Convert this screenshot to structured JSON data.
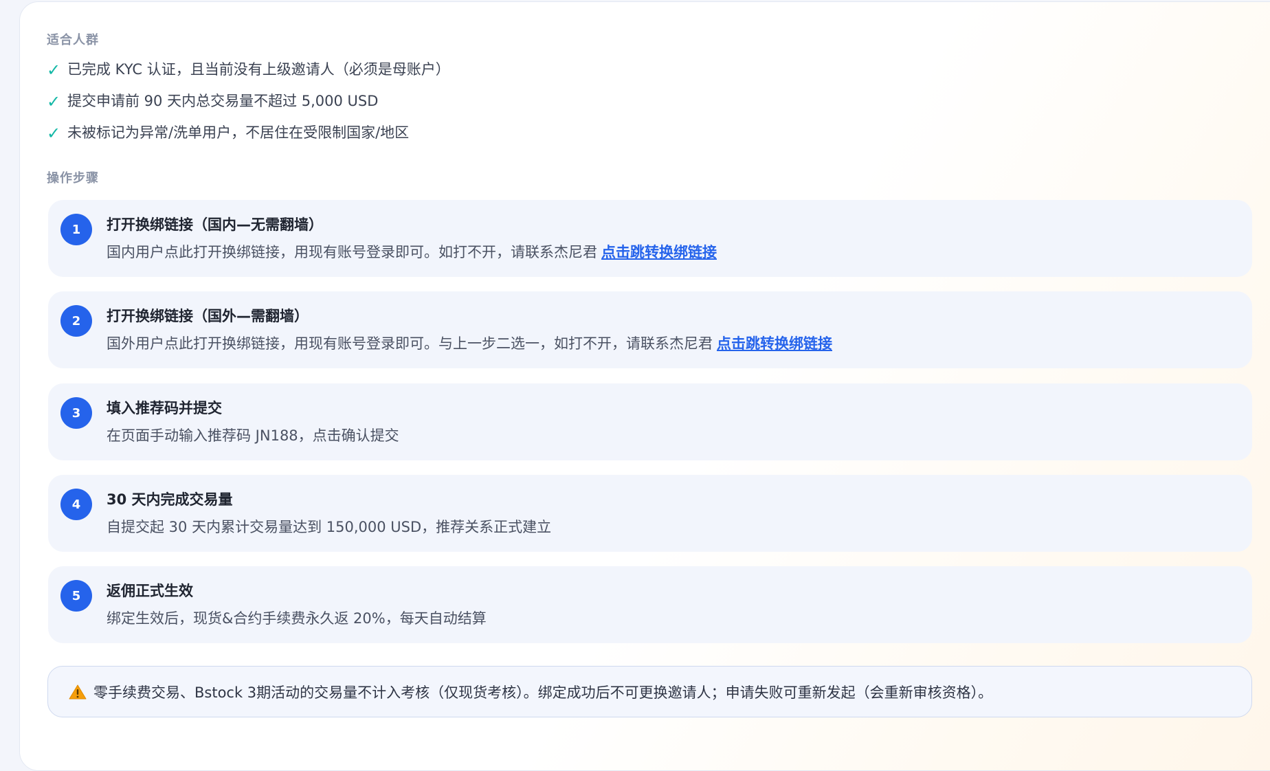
{
  "audience": {
    "label": "适合人群",
    "items": [
      "已完成 KYC 认证，且当前没有上级邀请人（必须是母账户）",
      "提交申请前 90 天内总交易量不超过 5,000 USD",
      "未被标记为异常/洗单用户，不居住在受限制国家/地区"
    ]
  },
  "steps_section": {
    "label": "操作步骤",
    "steps": [
      {
        "num": "1",
        "title": "打开换绑链接（国内—无需翻墙）",
        "desc": "国内用户点此打开换绑链接，用现有账号登录即可。如打不开，请联系杰尼君",
        "link": "点击跳转换绑链接"
      },
      {
        "num": "2",
        "title": "打开换绑链接（国外—需翻墙）",
        "desc": "国外用户点此打开换绑链接，用现有账号登录即可。与上一步二选一，如打不开，请联系杰尼君",
        "link": "点击跳转换绑链接"
      },
      {
        "num": "3",
        "title": "填入推荐码并提交",
        "desc": "在页面手动输入推荐码 JN188，点击确认提交"
      },
      {
        "num": "4",
        "title": "30 天内完成交易量",
        "desc": "自提交起 30 天内累计交易量达到 150,000 USD，推荐关系正式建立"
      },
      {
        "num": "5",
        "title": "返佣正式生效",
        "desc": "绑定生效后，现货&合约手续费永久返 20%，每天自动结算"
      }
    ]
  },
  "notice": {
    "text": "零手续费交易、Bstock 3期活动的交易量不计入考核（仅现货考核）。绑定成功后不可更换邀请人；申请失败可重新发起（会重新审核资格）。"
  },
  "icons": {
    "check": "check-icon",
    "warning": "warning-icon"
  },
  "colors": {
    "accent": "#2563eb",
    "check": "#14b8a6",
    "warning": "#f59e0b"
  }
}
